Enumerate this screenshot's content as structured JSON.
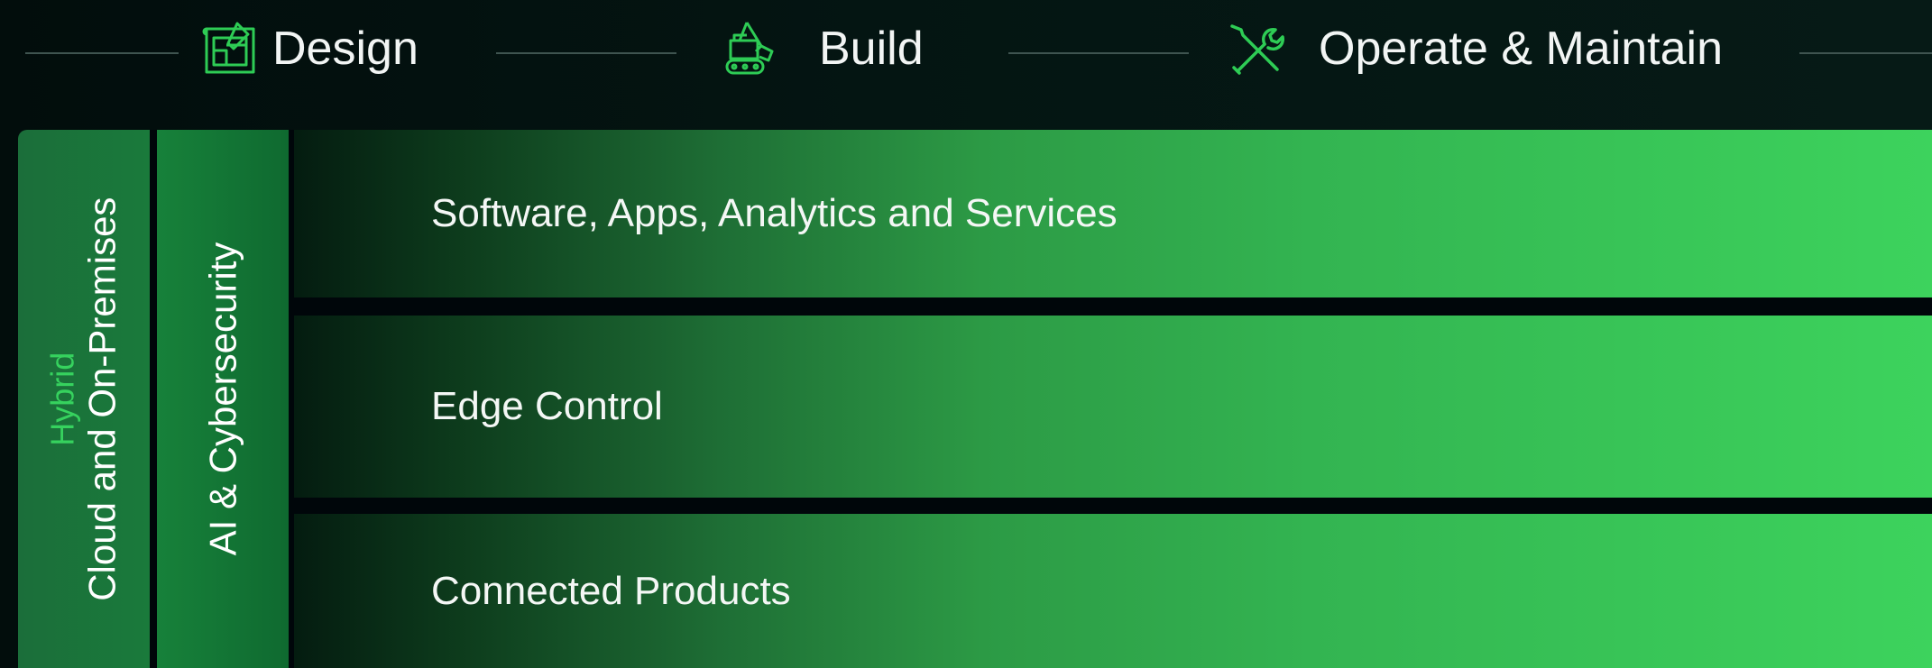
{
  "phases": [
    {
      "label": "Design",
      "icon": "blueprint-icon"
    },
    {
      "label": "Build",
      "icon": "excavator-icon"
    },
    {
      "label": "Operate & Maintain",
      "icon": "tools-icon"
    }
  ],
  "colors": {
    "accent_green": "#36d25e",
    "icon_green": "#2ecc55",
    "background": "#03120f",
    "column_green": "#1a7a3b"
  },
  "left_columns": {
    "hybrid": {
      "accent": "Hybrid",
      "main": "Cloud and On-Premises"
    },
    "ai": {
      "main": "AI & Cybersecurity"
    }
  },
  "layers": [
    {
      "label": "Software, Apps, Analytics and Services"
    },
    {
      "label": "Edge Control"
    },
    {
      "label": "Connected Products"
    }
  ]
}
